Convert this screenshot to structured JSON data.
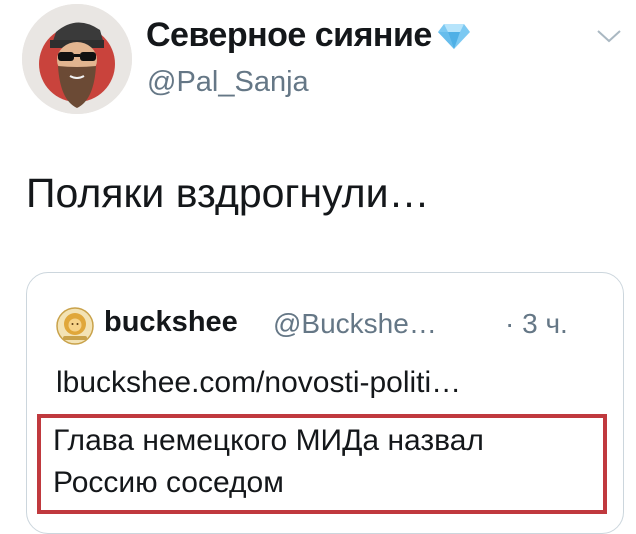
{
  "author": {
    "display_name": "Северное сияние",
    "handle": "@Pal_Sanja",
    "avatar_icon": "bearded-man-sunglasses-avatar",
    "badge_icon": "blue-diamond-icon"
  },
  "tweet": {
    "text": "Поляки вздрогнули…",
    "menu_icon": "chevron-down-icon"
  },
  "quoted": {
    "avatar_icon": "lion-logo-avatar",
    "display_name": "buckshee",
    "handle": "@Buckshe…",
    "time": "· 3 ч.",
    "link": "lbuckshee.com/novosti-politi…",
    "text_line1": "Глава немецкого МИДа назвал",
    "text_line2": "Россию соседом",
    "highlight_color": "#c0393e"
  }
}
